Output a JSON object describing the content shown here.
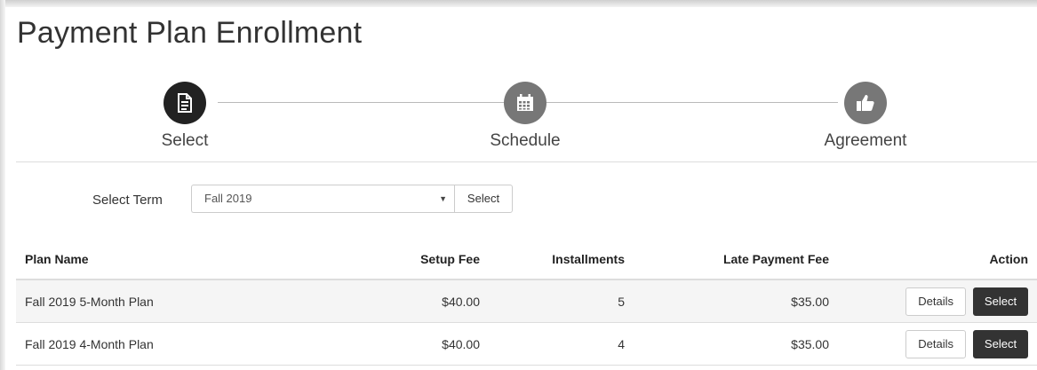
{
  "page": {
    "title": "Payment Plan Enrollment"
  },
  "stepper": {
    "steps": [
      {
        "label": "Select",
        "icon": "document-icon",
        "state": "active"
      },
      {
        "label": "Schedule",
        "icon": "calendar-icon",
        "state": "inactive"
      },
      {
        "label": "Agreement",
        "icon": "thumbs-up-icon",
        "state": "inactive"
      }
    ]
  },
  "term": {
    "label": "Select Term",
    "selected": "Fall 2019",
    "button_label": "Select"
  },
  "table": {
    "headers": {
      "plan_name": "Plan Name",
      "setup_fee": "Setup Fee",
      "installments": "Installments",
      "late_fee": "Late Payment Fee",
      "action": "Action"
    },
    "rows": [
      {
        "plan_name": "Fall 2019 5-Month Plan",
        "setup_fee": "$40.00",
        "installments": "5",
        "late_fee": "$35.00",
        "details_label": "Details",
        "select_label": "Select"
      },
      {
        "plan_name": "Fall 2019 4-Month Plan",
        "setup_fee": "$40.00",
        "installments": "4",
        "late_fee": "$35.00",
        "details_label": "Details",
        "select_label": "Select"
      }
    ]
  },
  "colors": {
    "active_step": "#222222",
    "inactive_step": "#777777",
    "primary_button": "#333333"
  }
}
